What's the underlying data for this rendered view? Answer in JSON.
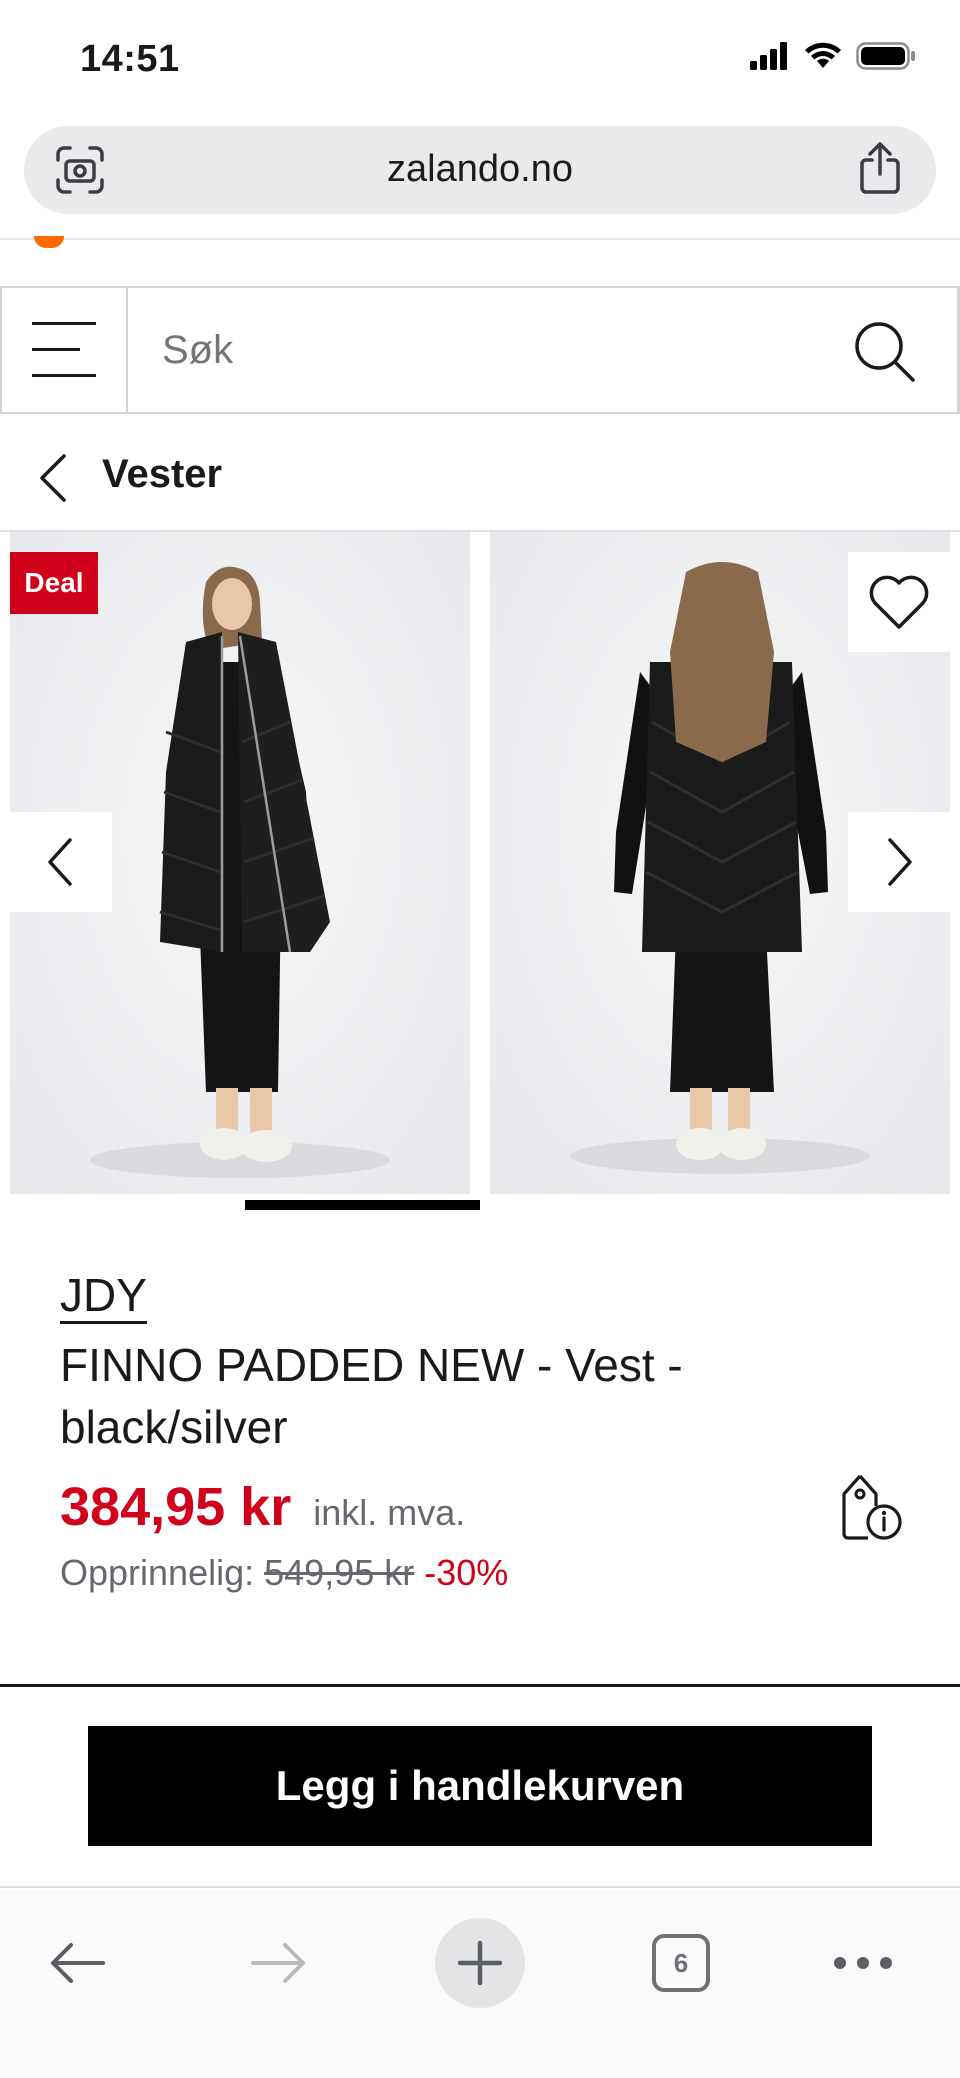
{
  "status_bar": {
    "time": "14:51"
  },
  "browser": {
    "url": "zalando.no",
    "open_tabs": "6"
  },
  "header": {
    "search_placeholder": "Søk"
  },
  "breadcrumb": {
    "title": "Vester"
  },
  "gallery": {
    "badge": "Deal",
    "images_count": 2
  },
  "product": {
    "brand": "JDY",
    "name": "FINNO PADDED NEW - Vest - black/silver",
    "price": "384,95 kr",
    "vat_note": "inkl. mva.",
    "original_label": "Opprinnelig:",
    "original_price": "549,95 kr",
    "discount": "-30%"
  },
  "actions": {
    "add_to_cart": "Legg i handlekurven"
  },
  "colors": {
    "sale_red": "#d0021b",
    "brand_orange": "#ff6900",
    "button_black": "#000000"
  },
  "icons": [
    "signal-icon",
    "wifi-icon",
    "battery-icon",
    "camera-search-icon",
    "share-icon",
    "menu-icon",
    "search-icon",
    "chevron-left-icon",
    "heart-icon",
    "chevron-right-icon",
    "price-tag-info-icon",
    "back-arrow-icon",
    "forward-arrow-icon",
    "plus-icon",
    "tabs-icon",
    "more-icon"
  ]
}
